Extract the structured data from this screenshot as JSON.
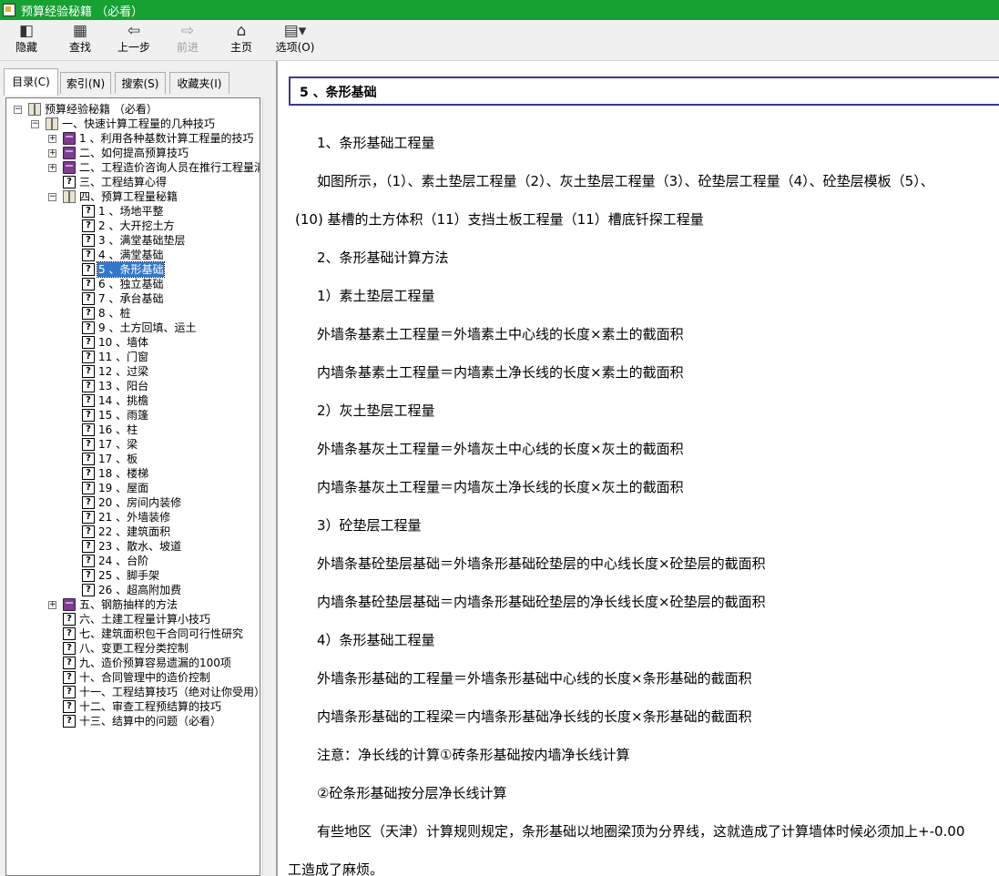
{
  "window": {
    "title": "预算经验秘籍 （必看）"
  },
  "toolbar": {
    "hide": "隐藏",
    "find": "查找",
    "back": "上一步",
    "forward": "前进",
    "home": "主页",
    "options": "选项(O)"
  },
  "tabs": {
    "contents": "目录(C)",
    "index": "索引(N)",
    "search": "搜索(S)",
    "favorites": "收藏夹(I)"
  },
  "tree": {
    "root": "预算经验秘籍 （必看）",
    "ch1": "一、快速计算工程量的几种技巧",
    "ch1_items": [
      "1 、利用各种基数计算工程量的技巧",
      "二、如何提高预算技巧",
      "二、工程造价咨询人员在推行工程量清",
      "三、工程结算心得"
    ],
    "ch4": "四、预算工程量秘籍",
    "ch4_items": [
      "1 、场地平整",
      "2 、大开挖土方",
      "3 、满堂基础垫层",
      "4 、满堂基础",
      "5 、条形基础",
      "6 、独立基础",
      "7 、承台基础",
      "8 、桩",
      "9 、土方回填、运土",
      "10 、墙体",
      "11 、门窗",
      "12 、过梁",
      "13 、阳台",
      "14 、挑檐",
      "15 、雨篷",
      "16 、柱",
      "17 、梁",
      "17 、板",
      "18 、楼梯",
      "19 、屋面",
      "20 、房间内装修",
      "21 、外墙装修",
      "22 、建筑面积",
      "23 、散水、坡道",
      "24 、台阶",
      "25 、脚手架",
      "26 、超高附加费"
    ],
    "ch5": "五、钢筋抽样的方法",
    "tail_items": [
      "六、土建工程量计算小技巧",
      "七、建筑面积包干合同可行性研究",
      "八、变更工程分类控制",
      "九、造价预算容易遗漏的100项",
      "十、合同管理中的造价控制",
      "十一、工程结算技巧（绝对让你受用）",
      "十二、审查工程预结算的技巧",
      "十三、结算中的问题（必看）"
    ]
  },
  "content": {
    "title": "5 、条形基础",
    "paragraphs": [
      "1、条形基础工程量",
      "如图所示，（1）、素土垫层工程量（2）、灰土垫层工程量（3）、砼垫层工程量（4）、砼垫层模板（5）、",
      "(10) 基槽的土方体积（11）支挡土板工程量（11）槽底钎探工程量",
      "2、条形基础计算方法",
      "1）素土垫层工程量",
      "外墙条基素土工程量＝外墙素土中心线的长度×素土的截面积",
      "内墙条基素土工程量＝内墙素土净长线的长度×素土的截面积",
      "2）灰土垫层工程量",
      "外墙条基灰土工程量＝外墙灰土中心线的长度×灰土的截面积",
      "内墙条基灰土工程量＝内墙灰土净长线的长度×灰土的截面积",
      "3）砼垫层工程量",
      "外墙条基砼垫层基础＝外墙条形基础砼垫层的中心线长度×砼垫层的截面积",
      "内墙条基砼垫层基础＝内墙条形基础砼垫层的净长线长度×砼垫层的截面积",
      "4）条形基础工程量",
      "外墙条形基础的工程量＝外墙条形基础中心线的长度×条形基础的截面积",
      "内墙条形基础的工程梁＝内墙条形基础净长线的长度×条形基础的截面积",
      "注意：净长线的计算①砖条形基础按内墙净长线计算",
      "②砼条形基础按分层净长线计算",
      "有些地区（天津）计算规则规定，条形基础以地圈梁顶为分界线，这就造成了计算墙体时候必须加上+-0.00",
      "工造成了麻烦。"
    ]
  }
}
